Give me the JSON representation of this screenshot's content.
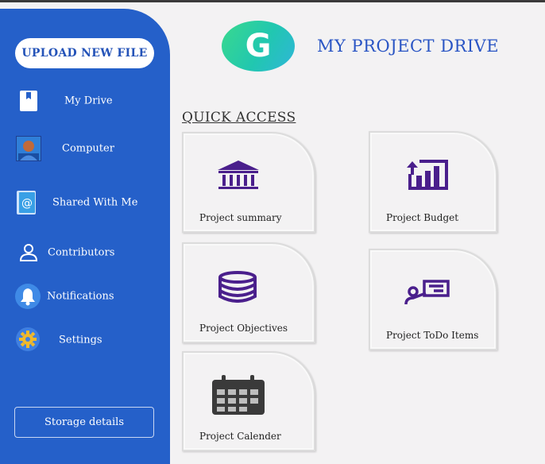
{
  "sidebar": {
    "upload_label": "UPLOAD NEW FILE",
    "items": [
      {
        "label": "My Drive",
        "icon": "book-icon"
      },
      {
        "label": "Computer",
        "icon": "user-photo-icon"
      },
      {
        "label": "Shared With Me",
        "icon": "at-sign-icon"
      },
      {
        "label": "Contributors",
        "icon": "person-icon"
      },
      {
        "label": "Notifications",
        "icon": "bell-icon"
      },
      {
        "label": "Settings",
        "icon": "gear-icon"
      }
    ],
    "storage_label": "Storage details"
  },
  "header": {
    "logo_letter": "G",
    "title": "MY PROJECT DRIVE"
  },
  "quick_access": {
    "title": "QUICK ACCESS",
    "cards": [
      {
        "label": "Project summary",
        "icon": "bank-icon"
      },
      {
        "label": "Project Budget",
        "icon": "bar-chart-icon"
      },
      {
        "label": "Project Objectives",
        "icon": "database-icon"
      },
      {
        "label": "Project ToDo Items",
        "icon": "presentation-icon"
      },
      {
        "label": "Project Calender",
        "icon": "calendar-icon"
      }
    ]
  },
  "colors": {
    "sidebar": "#2560c9",
    "accent": "#2a55c4",
    "icon_purple": "#4a1f8c",
    "background": "#f3f2f3"
  }
}
